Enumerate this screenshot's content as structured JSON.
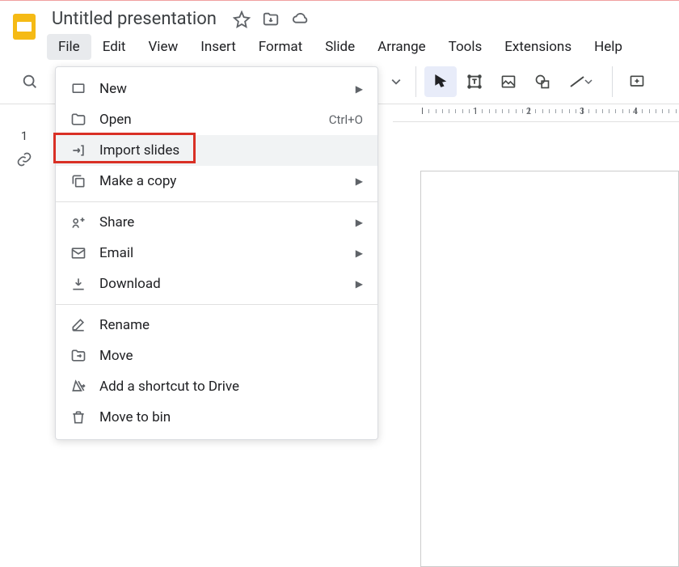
{
  "doc": {
    "title": "Untitled presentation"
  },
  "menubar": [
    "File",
    "Edit",
    "View",
    "Insert",
    "Format",
    "Slide",
    "Arrange",
    "Tools",
    "Extensions",
    "Help"
  ],
  "active_menu_index": 0,
  "file_menu": {
    "new": {
      "label": "New",
      "hasSubmenu": true
    },
    "open": {
      "label": "Open",
      "shortcut": "Ctrl+O"
    },
    "import": {
      "label": "Import slides"
    },
    "copy": {
      "label": "Make a copy",
      "hasSubmenu": true
    },
    "share": {
      "label": "Share",
      "hasSubmenu": true
    },
    "email": {
      "label": "Email",
      "hasSubmenu": true
    },
    "download": {
      "label": "Download",
      "hasSubmenu": true
    },
    "rename": {
      "label": "Rename"
    },
    "move": {
      "label": "Move"
    },
    "shortcut": {
      "label": "Add a shortcut to Drive"
    },
    "bin": {
      "label": "Move to bin"
    }
  },
  "slide_panel": {
    "selected_number": "1"
  },
  "ruler": {
    "ticks": [
      "1",
      "2",
      "3",
      "4"
    ]
  }
}
